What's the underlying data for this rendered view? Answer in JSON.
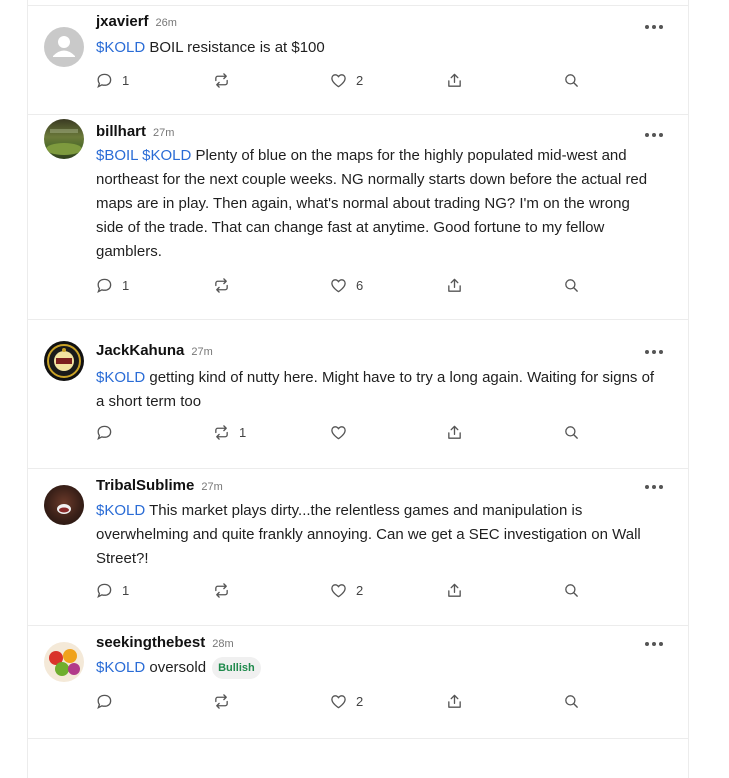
{
  "posts": [
    {
      "username": "jxavierf",
      "time": "26m",
      "avatar": "default-avatar",
      "body": [
        {
          "type": "cashtag",
          "text": "$KOLD"
        },
        {
          "type": "text",
          "text": " BOIL resistance is at $100"
        }
      ],
      "actions": {
        "reply": "1",
        "reshare": "",
        "like": "2"
      }
    },
    {
      "username": "billhart",
      "time": "27m",
      "avatar": "landscape-avatar",
      "body": [
        {
          "type": "cashtag",
          "text": "$BOIL"
        },
        {
          "type": "text",
          "text": " "
        },
        {
          "type": "cashtag",
          "text": "$KOLD"
        },
        {
          "type": "text",
          "text": " Plenty of blue on the maps for the highly populated mid-west and northeast for the next couple weeks. NG normally starts down before the actual red maps are in play. Then again, what's normal about trading NG? I'm on the wrong side of the trade. That can change fast at anytime. Good fortune to my fellow gamblers."
        }
      ],
      "actions": {
        "reply": "1",
        "reshare": "",
        "like": "6"
      }
    },
    {
      "username": "JackKahuna",
      "time": "27m",
      "avatar": "badge-logo-avatar",
      "body": [
        {
          "type": "cashtag",
          "text": "$KOLD"
        },
        {
          "type": "text",
          "text": " getting kind of nutty here. Might have to try a long again. Waiting for signs of a short term too"
        }
      ],
      "actions": {
        "reply": "",
        "reshare": "1",
        "like": ""
      }
    },
    {
      "username": "TribalSublime",
      "time": "27m",
      "avatar": "face-avatar",
      "body": [
        {
          "type": "cashtag",
          "text": "$KOLD"
        },
        {
          "type": "text",
          "text": " This market plays dirty...the relentless games and manipulation is overwhelming and quite frankly annoying. Can we get a SEC investigation on Wall Street?!"
        }
      ],
      "actions": {
        "reply": "1",
        "reshare": "",
        "like": "2"
      }
    },
    {
      "username": "seekingthebest",
      "time": "28m",
      "avatar": "fruit-avatar",
      "body": [
        {
          "type": "cashtag",
          "text": "$KOLD"
        },
        {
          "type": "text",
          "text": " oversold"
        }
      ],
      "badge": "Bullish",
      "actions": {
        "reply": "",
        "reshare": "",
        "like": "2"
      }
    }
  ],
  "colors": {
    "cashtag": "#2a6cd6",
    "bullish": "#1f8a4c",
    "border": "#ececec"
  }
}
